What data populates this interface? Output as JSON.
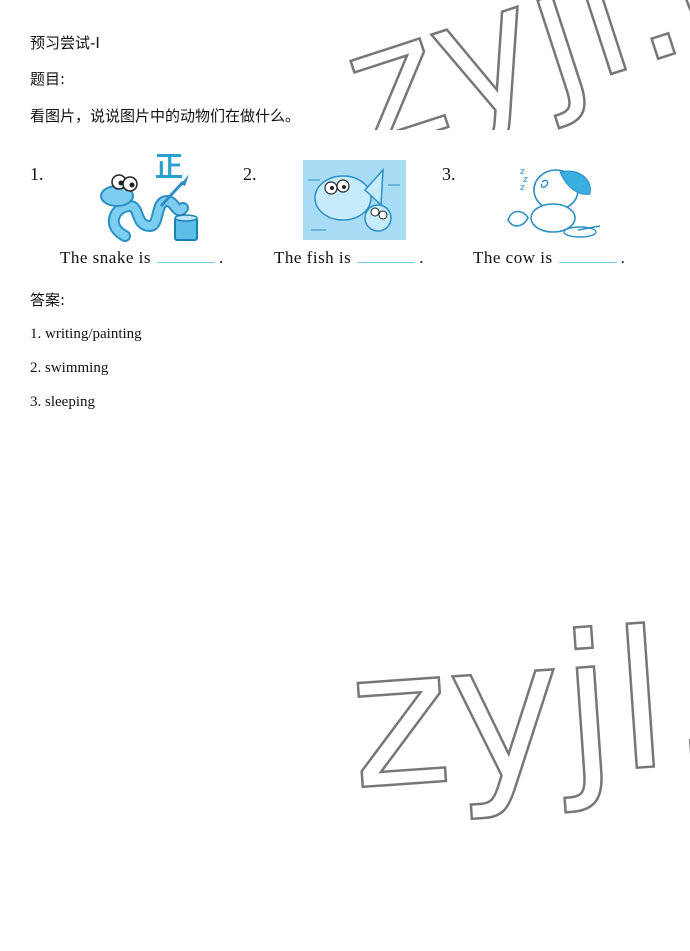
{
  "header": {
    "section_title": "预习尝试-I",
    "question_label": "题目:",
    "instruction": "看图片，说说图片中的动物们在做什么。"
  },
  "exercises": [
    {
      "number": "1.",
      "sentence_start": "The snake is",
      "sentence_end": ".",
      "image": "snake-painting-illustration"
    },
    {
      "number": "2.",
      "sentence_start": "The fish is",
      "sentence_end": ".",
      "image": "fish-swimming-illustration"
    },
    {
      "number": "3.",
      "sentence_start": "The cow is",
      "sentence_end": ".",
      "image": "cow-sleeping-illustration"
    }
  ],
  "answers": {
    "label": "答案:",
    "items": [
      "1. writing/painting",
      "2. swimming",
      "3. sleeping"
    ]
  },
  "watermark": {
    "text": "zyjl.c"
  },
  "colors": {
    "illustration": "#3aaee0",
    "illustration_bg": "#a8dcf5",
    "blank_line": "#6fd0e6",
    "watermark": "#777777"
  }
}
